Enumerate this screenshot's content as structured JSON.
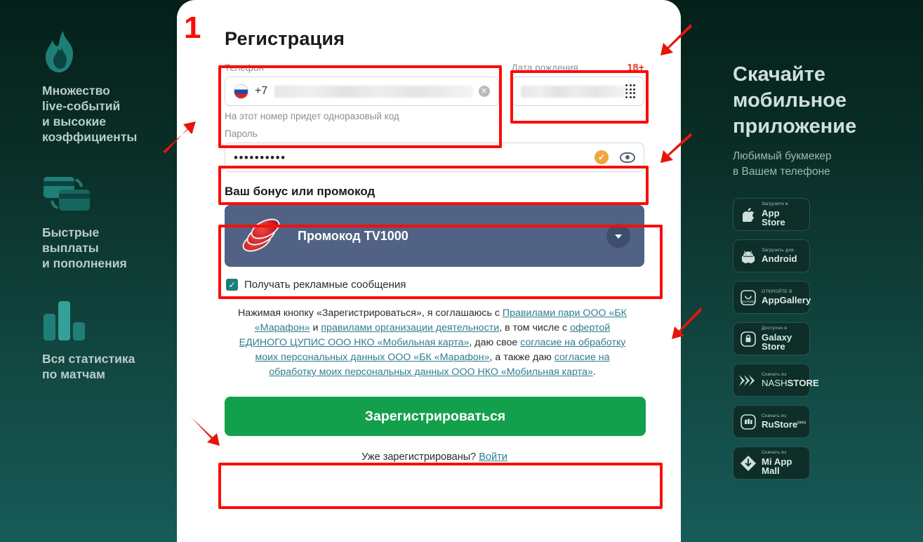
{
  "left_features": [
    {
      "icon": "flame-icon",
      "text": "Множество\nlive-событий\nи высокие\nкоэффициенты"
    },
    {
      "icon": "card-swap-icon",
      "text": "Быстрые\nвыплаты\nи пополнения"
    },
    {
      "icon": "bar-chart-icon",
      "text": "Вся статистика\nпо матчам"
    }
  ],
  "form": {
    "title": "Регистрация",
    "phone": {
      "label": "Телефон",
      "dial_code": "+7",
      "flag": "ru-flag-icon",
      "value": "",
      "clear_icon": "clear-circle-icon",
      "hint": "На этот номер придет одноразовый код"
    },
    "dob": {
      "label": "Дата рождения",
      "age_badge": "18+",
      "value": "",
      "keypad_icon": "keypad-icon"
    },
    "password": {
      "label": "Пароль",
      "value": "••••••••••",
      "valid_icon": "check-badge-icon",
      "reveal_icon": "eye-icon"
    },
    "bonus": {
      "title": "Ваш бонус или промокод",
      "promo_label": "Промокод TV1000",
      "chips_icon": "casino-chips-icon",
      "expand_icon": "chevron-down-icon",
      "banner_color": "#516285"
    },
    "consent": {
      "checked": true,
      "label": "Получать рекламные сообщения"
    },
    "legal": {
      "parts": [
        {
          "t": "Нажимая кнопку «Зарегистрироваться», я соглашаюсь с ",
          "link": false
        },
        {
          "t": "Правилами пари ООО «БК «Марафон»",
          "link": true
        },
        {
          "t": " и ",
          "link": false
        },
        {
          "t": "правилами организации деятельности",
          "link": true
        },
        {
          "t": ", в том числе с ",
          "link": false
        },
        {
          "t": "офертой ЕДИНОГО ЦУПИС ООО НКО «Мобильная карта»",
          "link": true
        },
        {
          "t": ", даю свое ",
          "link": false
        },
        {
          "t": "согласие на обработку моих персональных данных ООО «БК «Марафон»",
          "link": true
        },
        {
          "t": ", а также даю ",
          "link": false
        },
        {
          "t": "согласие на обработку моих персональных данных ООО НКО «Мобильная карта»",
          "link": true
        },
        {
          "t": ".",
          "link": false
        }
      ]
    },
    "submit_label": "Зарегистрироваться",
    "login_prompt": "Уже зарегистрированы? ",
    "login_link": "Войти",
    "submit_color": "#13a04c"
  },
  "app_panel": {
    "title": "Скачайте\nмобильное\nприложение",
    "subtitle": "Любимый букмекер\nв Вашем телефоне",
    "badges": [
      {
        "icon": "apple-icon",
        "small": "Загрузите в",
        "big": "App Store",
        "beta": ""
      },
      {
        "icon": "android-icon",
        "small": "Загрузить для",
        "big": "Android",
        "beta": ""
      },
      {
        "icon": "huawei-icon",
        "small": "ОТКРОЙТЕ В",
        "big": "AppGallery",
        "beta": ""
      },
      {
        "icon": "galaxy-icon",
        "small": "Доступно в",
        "big": "Galaxy Store",
        "beta": ""
      },
      {
        "icon": "nashstore-icon",
        "small": "Скачать из",
        "big": "NASHSTORE",
        "beta": ""
      },
      {
        "icon": "rustore-icon",
        "small": "Скачать из",
        "big": "RuStore",
        "beta": "beta"
      },
      {
        "icon": "miappmall-icon",
        "small": "Скачать из",
        "big": "Mi App Mall",
        "beta": ""
      }
    ]
  },
  "annotations": {
    "step_number": "1",
    "highlight_color": "#fa0d09",
    "arrow_count": 4
  }
}
